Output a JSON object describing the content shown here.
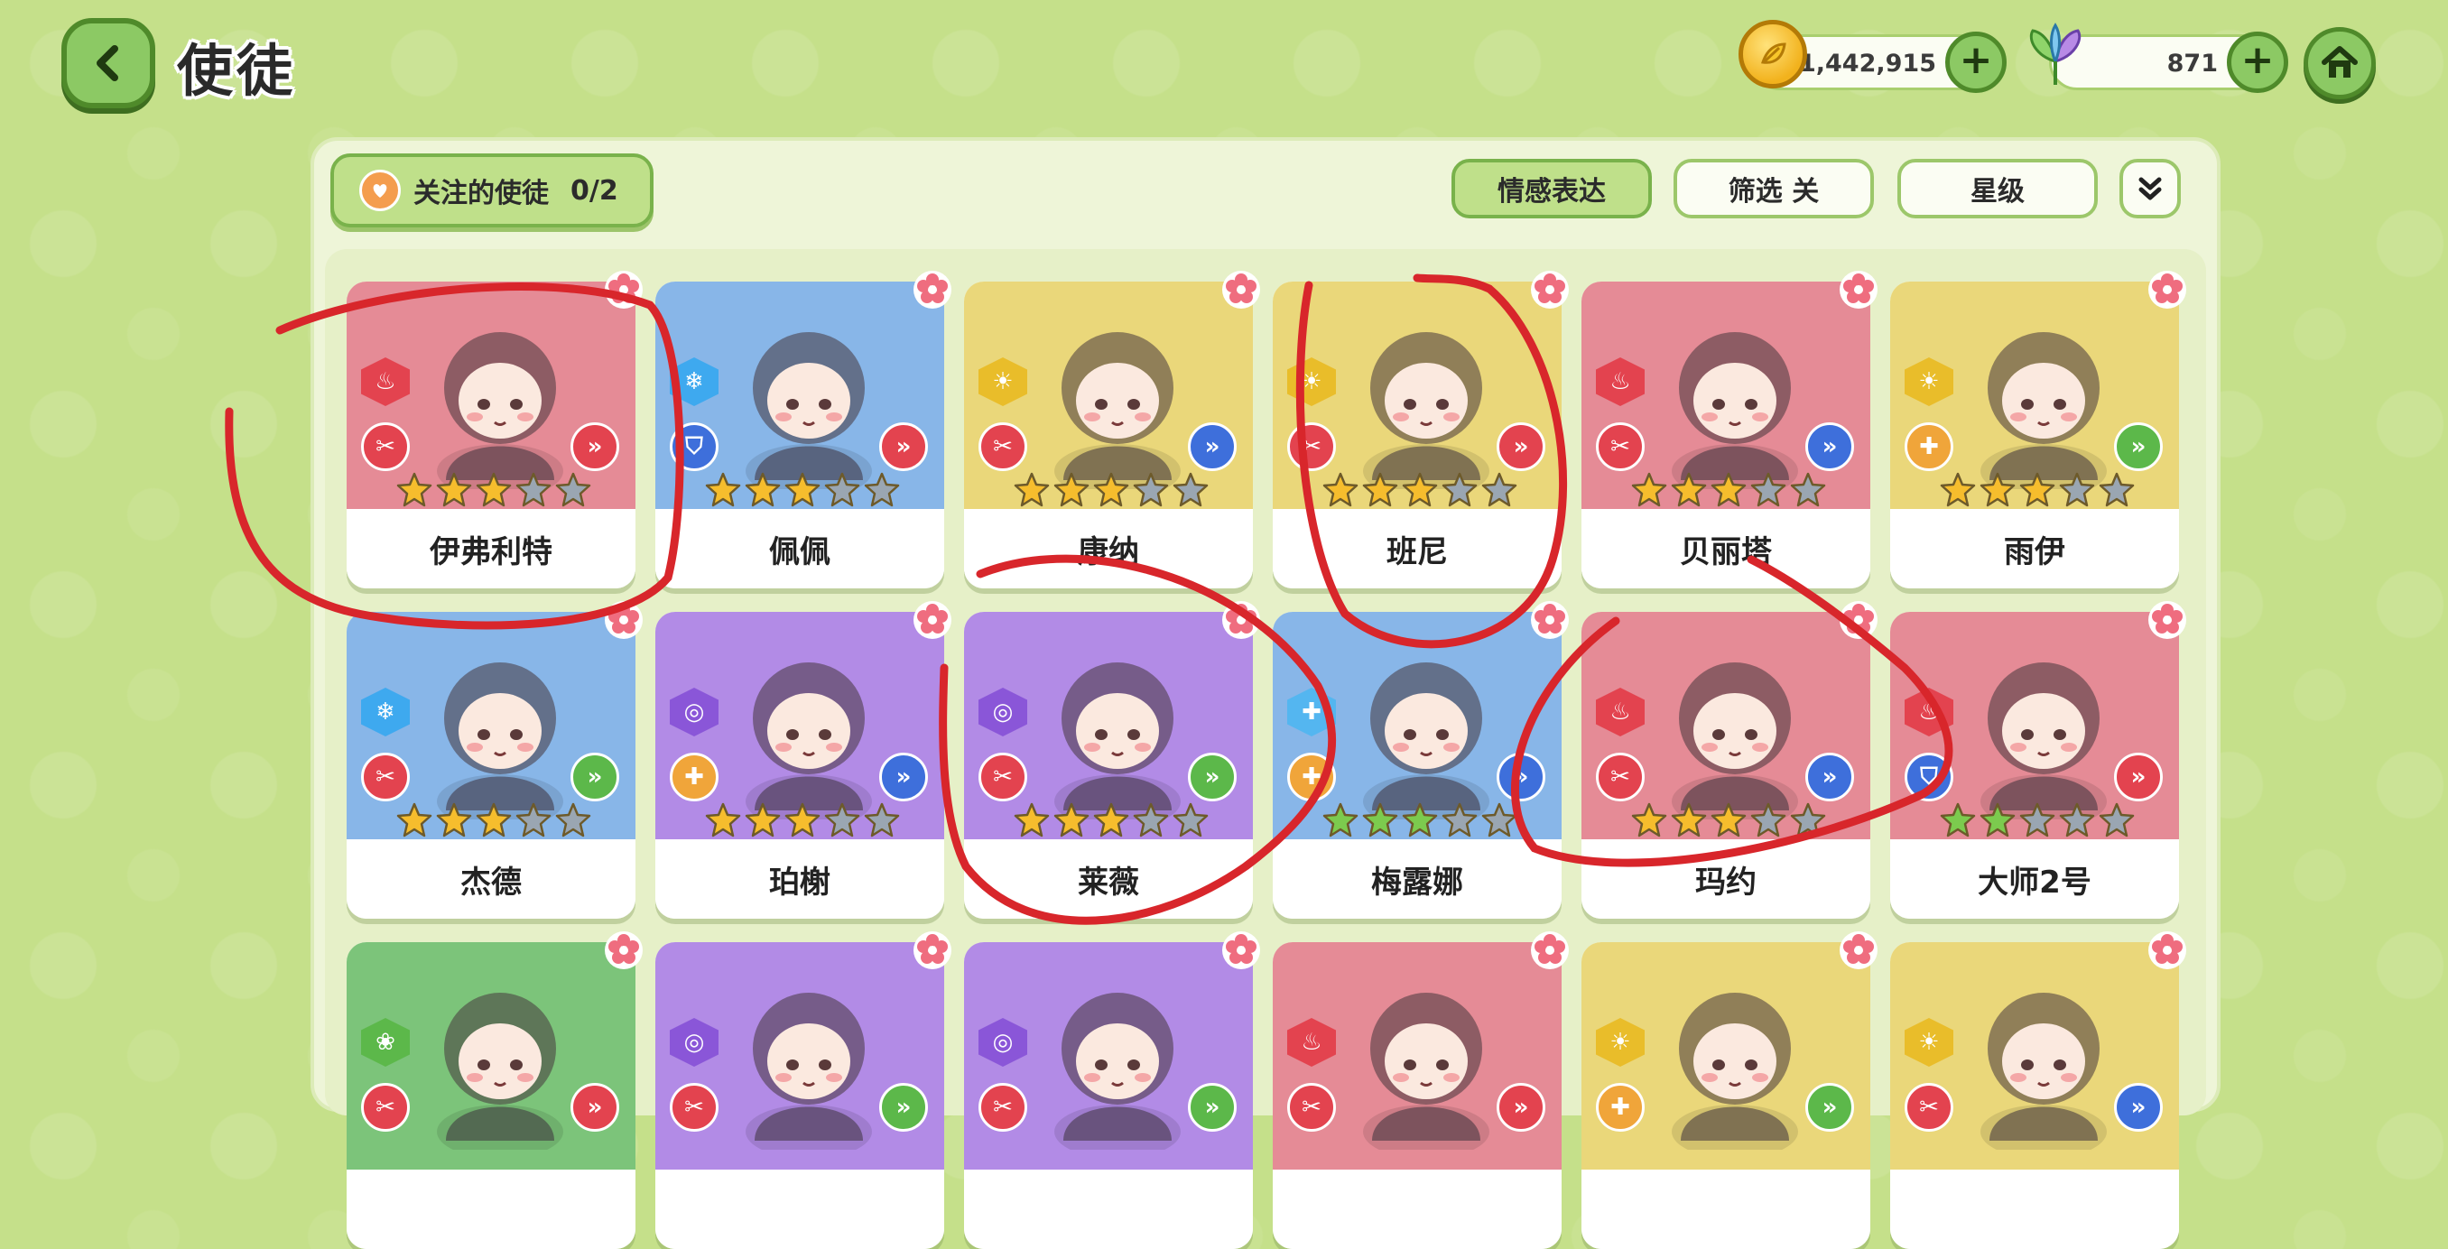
{
  "header": {
    "title": "使徒",
    "coins": "1,442,915",
    "gems": "871"
  },
  "toolbar": {
    "followed_label": "关注的使徒",
    "followed_count": "0/2",
    "emotion_label": "情感表达",
    "filter_label": "筛选 关",
    "star_label": "星级"
  },
  "colors": {
    "fire": "#e3434f",
    "ice": "#3ea9ef",
    "light": "#e9bd2a",
    "holy": "#54b6f0",
    "arcane": "#8a56d8",
    "nature": "#5cb84a"
  },
  "characters": [
    {
      "name": "伊弗利特",
      "bg": "#e58b96",
      "element": "fire",
      "role": "attack",
      "position": "red",
      "stars": 3,
      "star_color": "gold"
    },
    {
      "name": "佩佩",
      "bg": "#88b6e8",
      "element": "ice",
      "role": "shield",
      "position": "red",
      "stars": 3,
      "star_color": "gold"
    },
    {
      "name": "康纳",
      "bg": "#ead77a",
      "element": "light",
      "role": "attack",
      "position": "blue",
      "stars": 3,
      "star_color": "gold"
    },
    {
      "name": "班尼",
      "bg": "#ead77a",
      "element": "light",
      "role": "attack",
      "position": "red",
      "stars": 3,
      "star_color": "gold"
    },
    {
      "name": "贝丽塔",
      "bg": "#e58b96",
      "element": "fire",
      "role": "attack",
      "position": "blue",
      "stars": 3,
      "star_color": "gold"
    },
    {
      "name": "雨伊",
      "bg": "#ead77a",
      "element": "light",
      "role": "heal",
      "position": "green",
      "stars": 3,
      "star_color": "gold"
    },
    {
      "name": "杰德",
      "bg": "#88b6e8",
      "element": "ice",
      "role": "attack",
      "position": "green",
      "stars": 3,
      "star_color": "gold"
    },
    {
      "name": "珀榭",
      "bg": "#b28be6",
      "element": "arcane",
      "role": "heal",
      "position": "blue",
      "stars": 3,
      "star_color": "gold"
    },
    {
      "name": "莱薇",
      "bg": "#b28be6",
      "element": "arcane",
      "role": "attack",
      "position": "green",
      "stars": 3,
      "star_color": "gold"
    },
    {
      "name": "梅露娜",
      "bg": "#88b6e8",
      "element": "holy",
      "role": "heal",
      "position": "blue",
      "stars": 3,
      "star_color": "green"
    },
    {
      "name": "玛约",
      "bg": "#e58b96",
      "element": "fire",
      "role": "attack",
      "position": "blue",
      "stars": 3,
      "star_color": "gold"
    },
    {
      "name": "大师2号",
      "bg": "#e58b96",
      "element": "fire",
      "role": "shield",
      "position": "red",
      "stars": 2,
      "star_color": "green"
    },
    {
      "name": "",
      "bg": "#7cc47a",
      "element": "nature",
      "role": "attack",
      "position": "red",
      "stars": 0,
      "star_color": "gold"
    },
    {
      "name": "",
      "bg": "#b28be6",
      "element": "arcane",
      "role": "attack",
      "position": "green",
      "stars": 0,
      "star_color": "gold"
    },
    {
      "name": "",
      "bg": "#b28be6",
      "element": "arcane",
      "role": "attack",
      "position": "green",
      "stars": 0,
      "star_color": "gold"
    },
    {
      "name": "",
      "bg": "#e58b96",
      "element": "fire",
      "role": "attack",
      "position": "red",
      "stars": 0,
      "star_color": "gold"
    },
    {
      "name": "",
      "bg": "#ead77a",
      "element": "light",
      "role": "heal",
      "position": "green",
      "stars": 0,
      "star_color": "gold"
    },
    {
      "name": "",
      "bg": "#ead77a",
      "element": "light",
      "role": "attack",
      "position": "blue",
      "stars": 0,
      "star_color": "gold"
    }
  ]
}
